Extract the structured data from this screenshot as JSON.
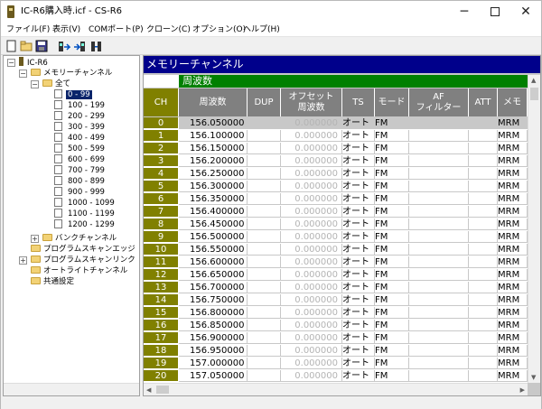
{
  "window": {
    "title": "IC-R6購入時.icf - CS-R6",
    "app_icon": "radio-icon"
  },
  "menu": [
    {
      "label": "ファイル(F)"
    },
    {
      "label": "表示(V)"
    },
    {
      "label": "COMポート(P)"
    },
    {
      "label": "クローン(C)"
    },
    {
      "label": "オプション(O)"
    },
    {
      "label": "ヘルプ(H)"
    }
  ],
  "toolbar": [
    {
      "icon": "new-file-icon"
    },
    {
      "icon": "open-folder-icon"
    },
    {
      "icon": "save-icon"
    },
    {
      "icon": "read-from-radio-icon"
    },
    {
      "icon": "write-to-radio-icon"
    },
    {
      "icon": "clone-icon"
    }
  ],
  "tree": {
    "root": "IC-R6",
    "memory": "メモリーチャンネル",
    "all": "全て",
    "ranges": [
      "0 - 99",
      "100 - 199",
      "200 - 299",
      "300 - 399",
      "400 - 499",
      "500 - 599",
      "600 - 699",
      "700 - 799",
      "800 - 899",
      "900 - 999",
      "1000 - 1099",
      "1100 - 1199",
      "1200 - 1299"
    ],
    "bank": "バンクチャンネル",
    "prog_scan_edge": "プログラムスキャンエッジ",
    "prog_scan_link": "プログラムスキャンリンク",
    "auto_write": "オートライトチャンネル",
    "common": "共通設定"
  },
  "grid": {
    "panel_title": "メモリーチャンネル",
    "group_header": "周波数",
    "columns": [
      "CH",
      "周波数",
      "DUP",
      "オフセット\n周波数",
      "TS",
      "モード",
      "AF\nフィルター",
      "ATT",
      "メモ"
    ],
    "offset_value": "0.000000",
    "ts_value": "オート",
    "mode_value": "FM",
    "memo_value": "MRM",
    "rows": [
      {
        "ch": "0",
        "freq": "156.050000"
      },
      {
        "ch": "1",
        "freq": "156.100000"
      },
      {
        "ch": "2",
        "freq": "156.150000"
      },
      {
        "ch": "3",
        "freq": "156.200000"
      },
      {
        "ch": "4",
        "freq": "156.250000"
      },
      {
        "ch": "5",
        "freq": "156.300000"
      },
      {
        "ch": "6",
        "freq": "156.350000"
      },
      {
        "ch": "7",
        "freq": "156.400000"
      },
      {
        "ch": "8",
        "freq": "156.450000"
      },
      {
        "ch": "9",
        "freq": "156.500000"
      },
      {
        "ch": "10",
        "freq": "156.550000"
      },
      {
        "ch": "11",
        "freq": "156.600000"
      },
      {
        "ch": "12",
        "freq": "156.650000"
      },
      {
        "ch": "13",
        "freq": "156.700000"
      },
      {
        "ch": "14",
        "freq": "156.750000"
      },
      {
        "ch": "15",
        "freq": "156.800000"
      },
      {
        "ch": "16",
        "freq": "156.850000"
      },
      {
        "ch": "17",
        "freq": "156.900000"
      },
      {
        "ch": "18",
        "freq": "156.950000"
      },
      {
        "ch": "19",
        "freq": "157.000000"
      },
      {
        "ch": "20",
        "freq": "157.050000"
      }
    ]
  },
  "colors": {
    "panel_title_bg": "#00008b",
    "group_header_bg": "#008000",
    "ch_column_bg": "#808000",
    "header_bg": "#808080"
  }
}
